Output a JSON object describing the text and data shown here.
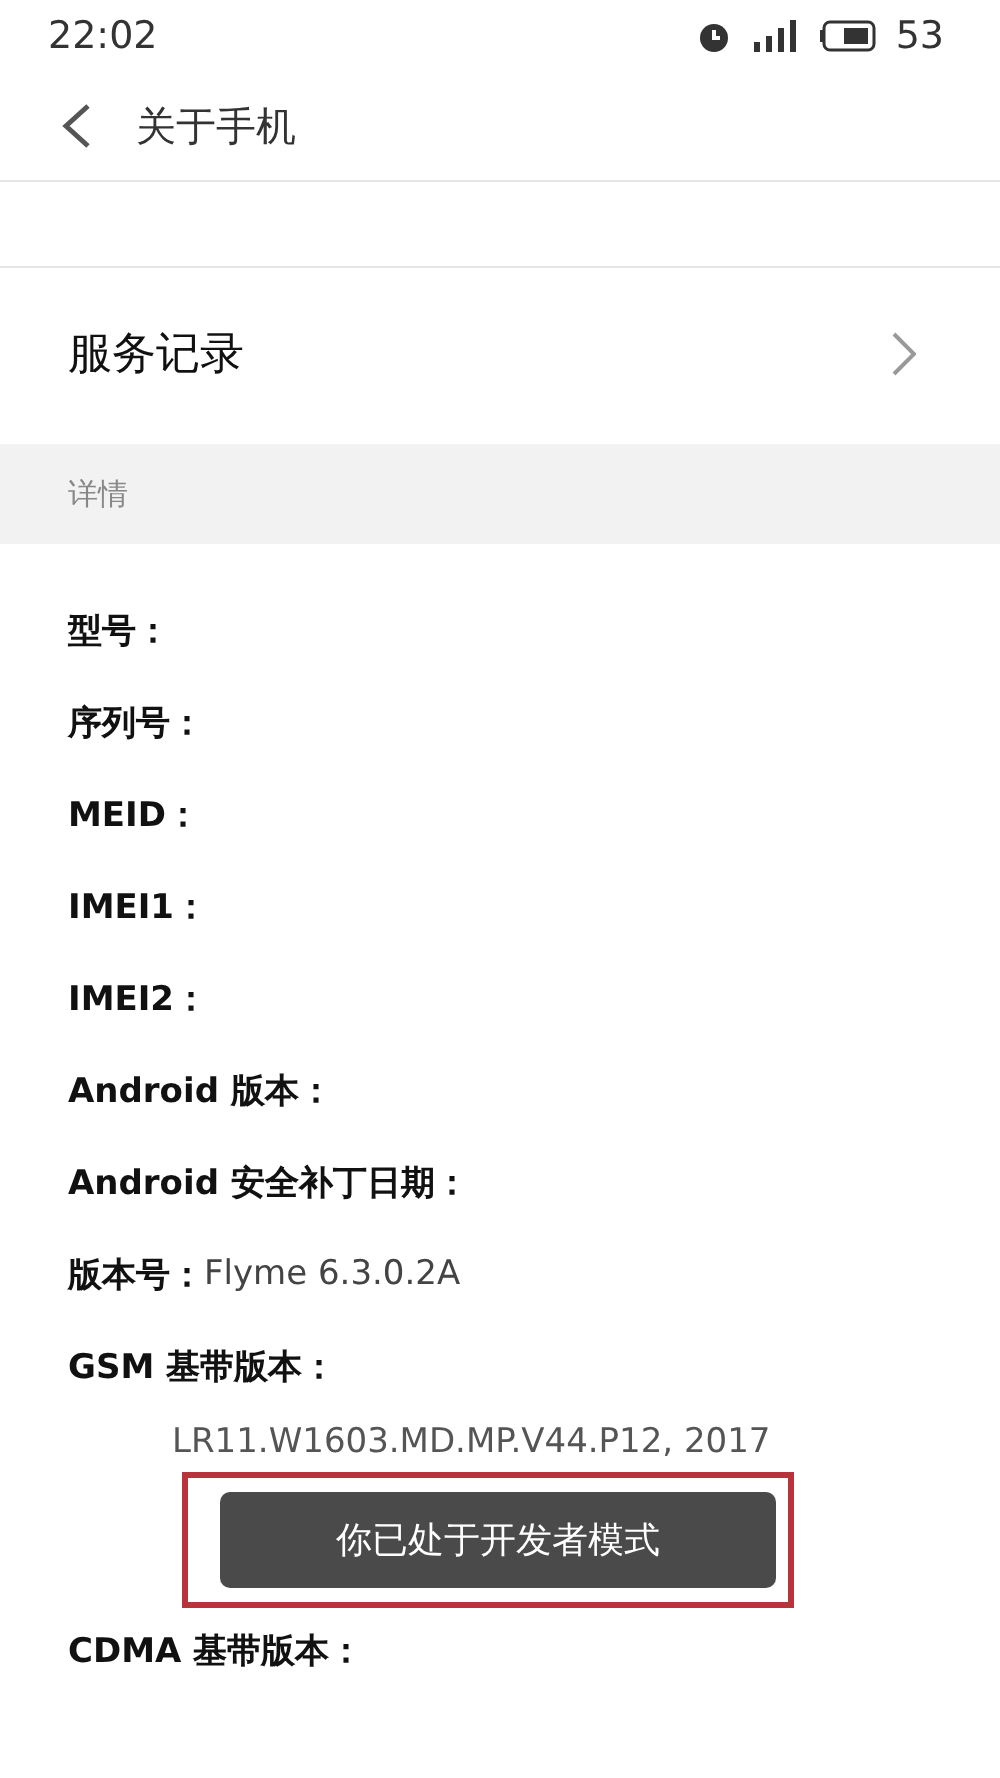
{
  "status_bar": {
    "time": "22:02",
    "battery": "53"
  },
  "header": {
    "title": "关于手机"
  },
  "nav_items": [
    {
      "label": "服务记录"
    }
  ],
  "section": {
    "title": "详情"
  },
  "details": [
    {
      "label": "型号："
    },
    {
      "label": "序列号："
    },
    {
      "label": "MEID："
    },
    {
      "label": "IMEI1："
    },
    {
      "label": "IMEI2："
    },
    {
      "label": "Android 版本："
    },
    {
      "label": "Android 安全补丁日期："
    },
    {
      "label": "版本号：",
      "value": "Flyme 6.3.0.2A"
    },
    {
      "label": "GSM 基带版本：",
      "value": "LR11.W1603.MD.MP.V44.P12, 2017"
    },
    {
      "label": "CDMA 基带版本："
    }
  ],
  "toast": {
    "text": "你已处于开发者模式"
  }
}
